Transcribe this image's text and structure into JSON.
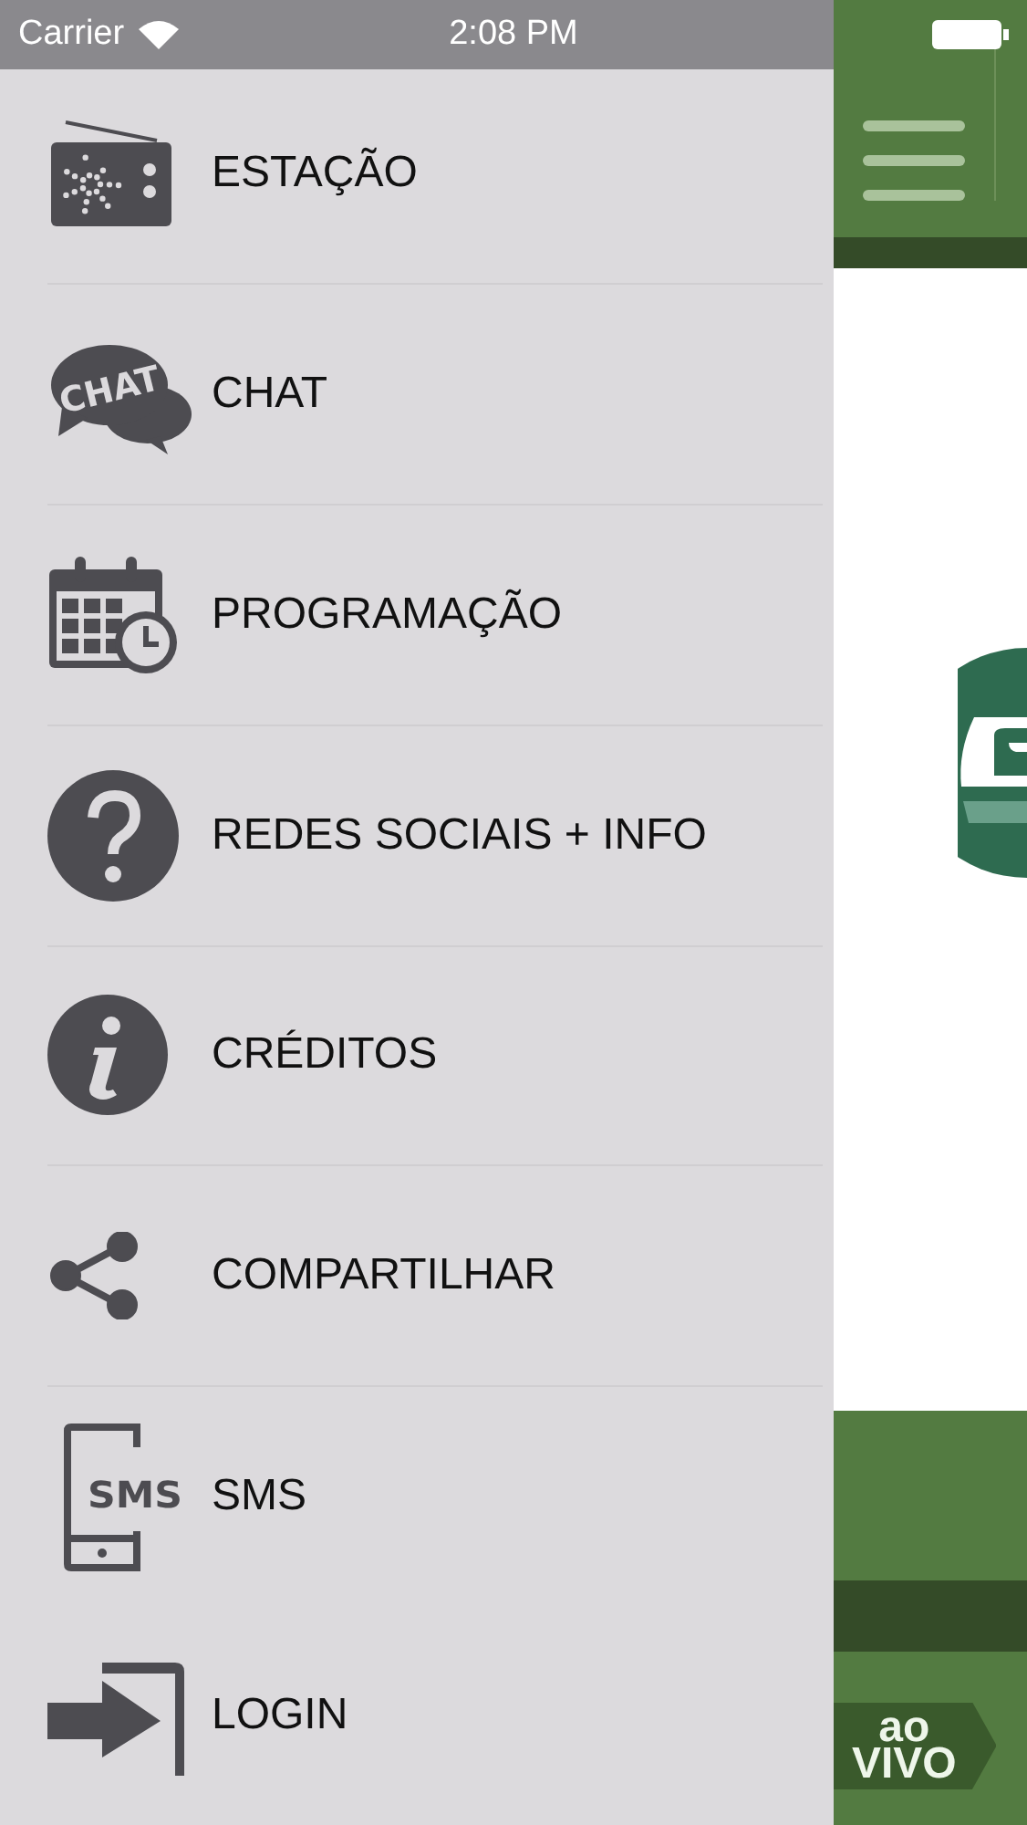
{
  "status_bar": {
    "carrier": "Carrier",
    "time": "2:08 PM"
  },
  "menu": [
    {
      "kind": "radio",
      "label": "ESTAÇÃO"
    },
    {
      "kind": "chat",
      "label": "CHAT",
      "icon_text": "CHAT"
    },
    {
      "kind": "calendar",
      "label": "PROGRAMAÇÃO"
    },
    {
      "kind": "question",
      "label": "REDES SOCIAIS + INFO"
    },
    {
      "kind": "info",
      "label": "CRÉDITOS"
    },
    {
      "kind": "share",
      "label": "COMPARTILHAR"
    },
    {
      "kind": "sms",
      "label": "SMS",
      "icon_text": "SMS"
    },
    {
      "kind": "login",
      "label": "LOGIN"
    }
  ],
  "live_badge": {
    "line_1": "ao",
    "line_2": "VIVO"
  }
}
